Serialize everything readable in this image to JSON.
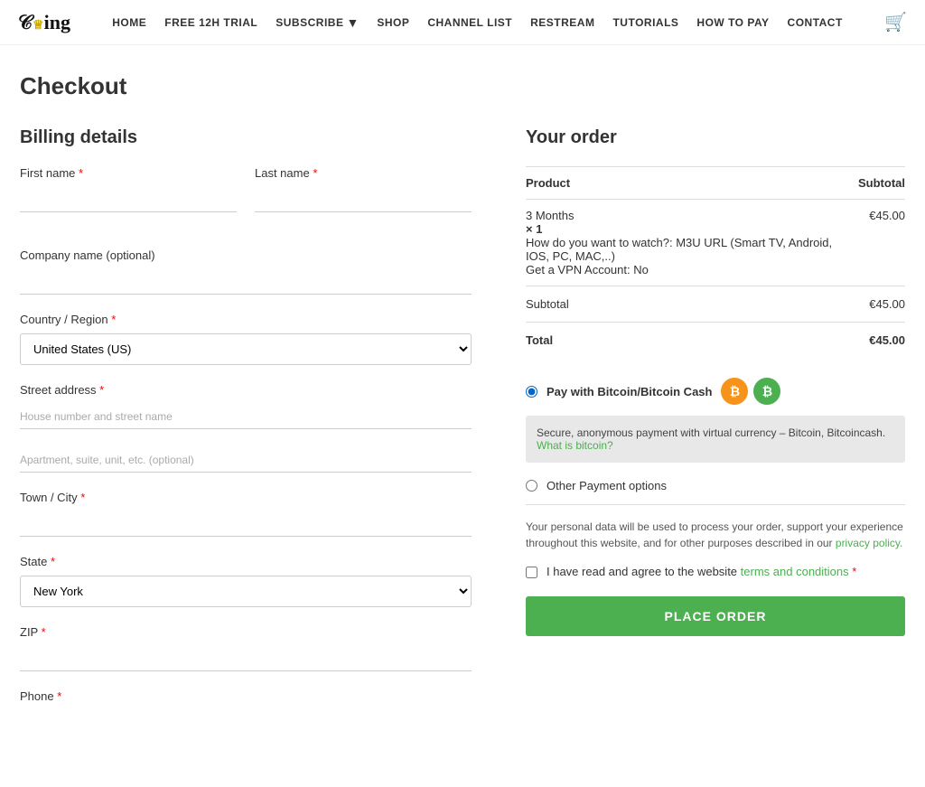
{
  "nav": {
    "logo_text": "King",
    "links": [
      {
        "label": "HOME",
        "name": "home"
      },
      {
        "label": "FREE 12H TRIAL",
        "name": "free-trial"
      },
      {
        "label": "SUBSCRIBE",
        "name": "subscribe",
        "has_dropdown": true
      },
      {
        "label": "SHOP",
        "name": "shop"
      },
      {
        "label": "CHANNEL LIST",
        "name": "channel-list"
      },
      {
        "label": "RESTREAM",
        "name": "restream"
      },
      {
        "label": "TUTORIALS",
        "name": "tutorials"
      },
      {
        "label": "HOW TO PAY",
        "name": "how-to-pay"
      },
      {
        "label": "CONTACT",
        "name": "contact"
      }
    ]
  },
  "page": {
    "title": "Checkout"
  },
  "billing": {
    "title": "Billing details",
    "first_name_label": "First name",
    "last_name_label": "Last name",
    "company_name_label": "Company name (optional)",
    "country_label": "Country / Region",
    "country_value": "United States (US)",
    "street_label": "Street address",
    "street_placeholder": "House number and street name",
    "apt_placeholder": "Apartment, suite, unit, etc. (optional)",
    "city_label": "Town / City",
    "state_label": "State",
    "state_value": "New York",
    "zip_label": "ZIP",
    "phone_label": "Phone"
  },
  "order": {
    "title": "Your order",
    "product_col": "Product",
    "subtotal_col": "Subtotal",
    "product_name": "3 Months",
    "product_qty": "× 1",
    "product_watch": "How do you want to watch?:",
    "product_watch_value": "M3U URL (Smart TV, Android, IOS, PC, MAC,..)",
    "product_vpn": "Get a VPN Account: No",
    "product_price": "€45.00",
    "subtotal_label": "Subtotal",
    "subtotal_value": "€45.00",
    "total_label": "Total",
    "total_value": "€45.00"
  },
  "payment": {
    "option1_label": "Pay with Bitcoin/Bitcoin Cash",
    "option1_desc": "Secure, anonymous payment with virtual currency – Bitcoin, Bitcoincash.",
    "option1_link_text": "What is bitcoin?",
    "option2_label": "Other Payment options",
    "privacy_text": "Your personal data will be used to process your order, support your experience throughout this website, and for other purposes described in our",
    "privacy_link": "privacy policy.",
    "terms_text": "I have read and agree to the website",
    "terms_link": "terms and conditions",
    "place_order": "PLACE ORDER"
  }
}
